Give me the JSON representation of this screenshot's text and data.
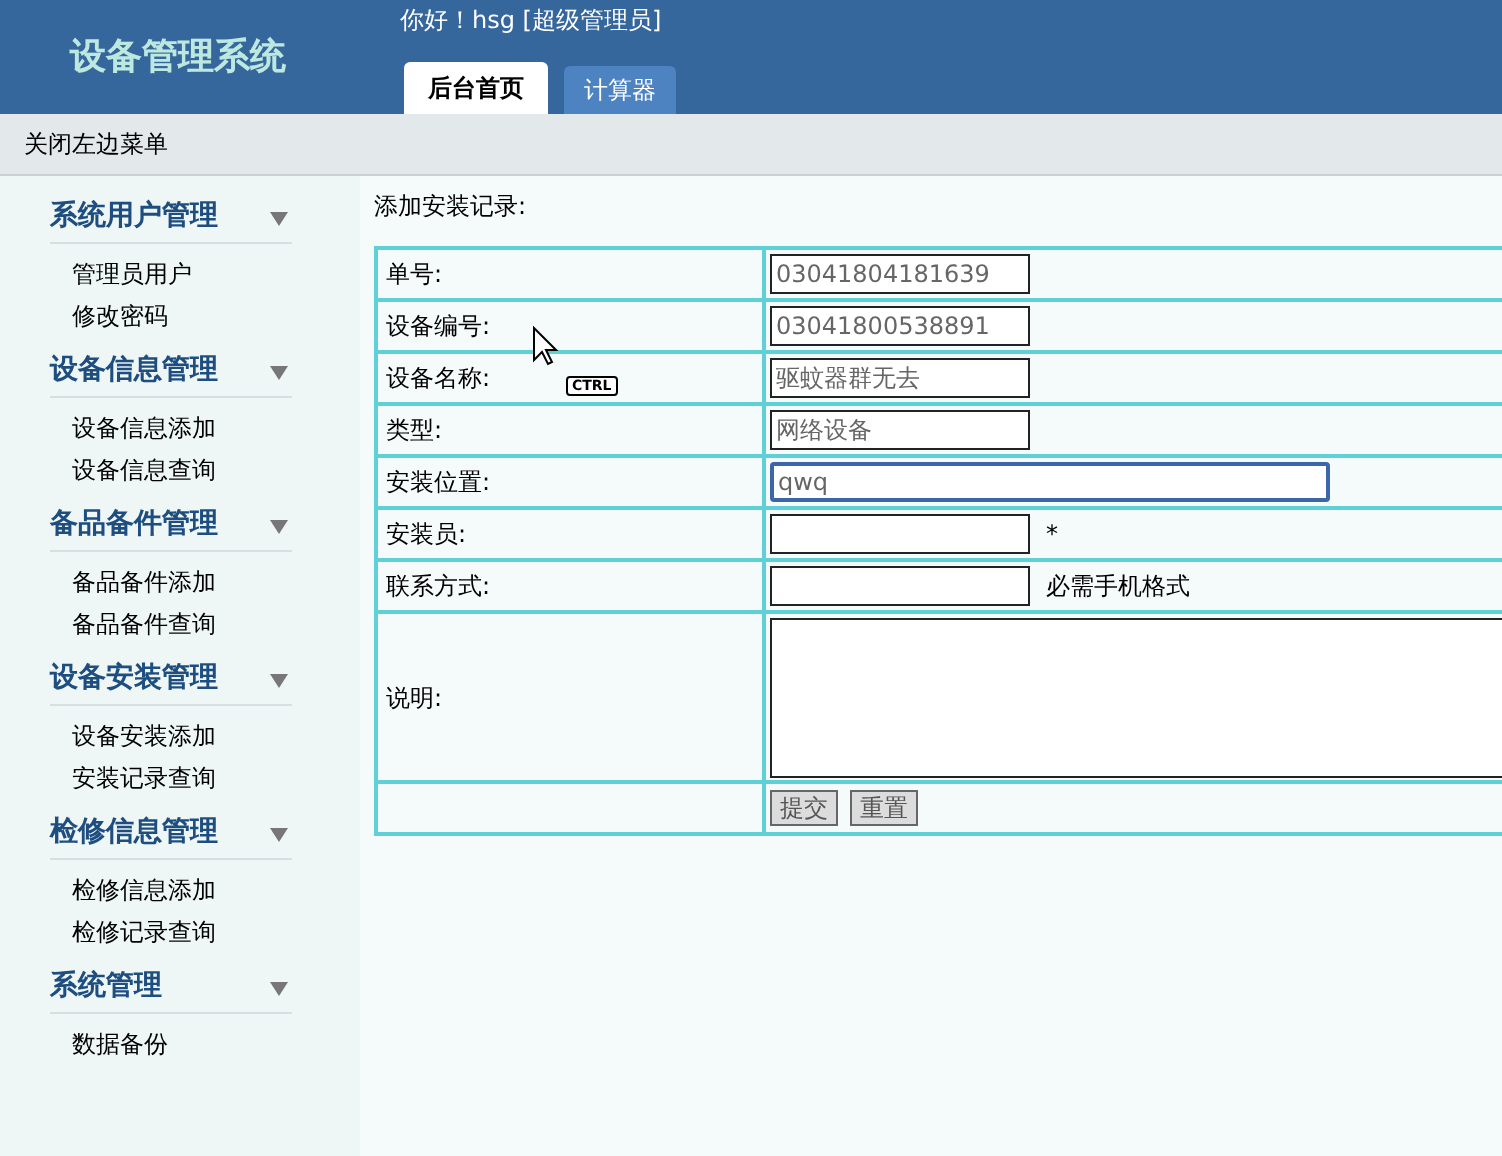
{
  "header": {
    "title": "设备管理系统",
    "greeting": "你好！hsg [超级管理员]",
    "tabs": [
      {
        "label": "后台首页",
        "selected": true
      },
      {
        "label": "计算器",
        "selected": false
      }
    ]
  },
  "toolbar": {
    "toggle_link": "关闭左边菜单"
  },
  "sidebar": {
    "groups": [
      {
        "title": "系统用户管理",
        "expanded": true,
        "items": [
          "管理员用户",
          "修改密码"
        ]
      },
      {
        "title": "设备信息管理",
        "expanded": true,
        "items": [
          "设备信息添加",
          "设备信息查询"
        ]
      },
      {
        "title": "备品备件管理",
        "expanded": true,
        "items": [
          "备品备件添加",
          "备品备件查询"
        ]
      },
      {
        "title": "设备安装管理",
        "expanded": true,
        "items": [
          "设备安装添加",
          "安装记录查询"
        ]
      },
      {
        "title": "检修信息管理",
        "expanded": true,
        "items": [
          "检修信息添加",
          "检修记录查询"
        ]
      },
      {
        "title": "系统管理",
        "expanded": true,
        "items": [
          "数据备份"
        ]
      }
    ]
  },
  "form": {
    "heading": "添加安装记录:",
    "rows": [
      {
        "kind": "input",
        "label": "单号:",
        "value": "03041804181639",
        "focused": false
      },
      {
        "kind": "input",
        "label": "设备编号:",
        "value": "03041800538891",
        "focused": false
      },
      {
        "kind": "input",
        "label": "设备名称:",
        "value": "驱蚊器群无去",
        "focused": false
      },
      {
        "kind": "input",
        "label": "类型:",
        "value": "网络设备",
        "focused": false
      },
      {
        "kind": "wide_input",
        "label": "安装位置:",
        "value": "qwq",
        "focused": true
      },
      {
        "kind": "input",
        "label": "安装员:",
        "focused": false,
        "note": "*"
      },
      {
        "kind": "input",
        "label": "联系方式:",
        "focused": false,
        "note": "必需手机格式"
      },
      {
        "kind": "textarea",
        "label": "说明:"
      },
      {
        "kind": "buttons",
        "buttons": [
          "提交",
          "重置"
        ]
      }
    ]
  },
  "cursor": {
    "shortcut": "CTRL"
  }
}
